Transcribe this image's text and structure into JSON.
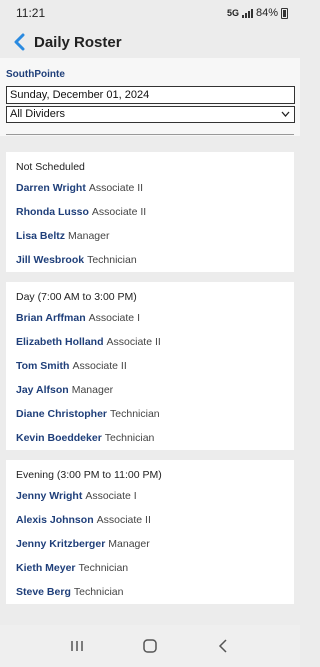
{
  "status": {
    "time": "11:21",
    "network": "5G",
    "battery": "84%"
  },
  "header": {
    "title": "Daily Roster",
    "back_icon": "chevron-left-icon",
    "accent": "#2a8ae0"
  },
  "filters": {
    "site": "SouthPointe",
    "date": "Sunday, December 01, 2024",
    "divider": "All Dividers"
  },
  "shifts": [
    {
      "title": "Not Scheduled",
      "employees": [
        {
          "name": "Darren Wright",
          "role": "Associate II"
        },
        {
          "name": "Rhonda Lusso",
          "role": "Associate II"
        },
        {
          "name": "Lisa Beltz",
          "role": "Manager"
        },
        {
          "name": "Jill Wesbrook",
          "role": "Technician"
        }
      ]
    },
    {
      "title": "Day (7:00 AM to 3:00 PM)",
      "employees": [
        {
          "name": "Brian Arffman",
          "role": "Associate I"
        },
        {
          "name": "Elizabeth Holland",
          "role": "Associate II"
        },
        {
          "name": "Tom Smith",
          "role": "Associate II"
        },
        {
          "name": "Jay Alfson",
          "role": "Manager"
        },
        {
          "name": "Diane Christopher",
          "role": "Technician"
        },
        {
          "name": "Kevin Boeddeker",
          "role": "Technician"
        }
      ]
    },
    {
      "title": "Evening (3:00 PM to 11:00 PM)",
      "employees": [
        {
          "name": "Jenny Wright",
          "role": "Associate I"
        },
        {
          "name": "Alexis Johnson",
          "role": "Associate II"
        },
        {
          "name": "Jenny Kritzberger",
          "role": "Manager"
        },
        {
          "name": "Kieth Meyer",
          "role": "Technician"
        },
        {
          "name": "Steve Berg",
          "role": "Technician"
        }
      ]
    }
  ],
  "nav": {
    "recents_icon": "recents-icon",
    "home_icon": "home-icon",
    "back_icon": "back-icon"
  }
}
